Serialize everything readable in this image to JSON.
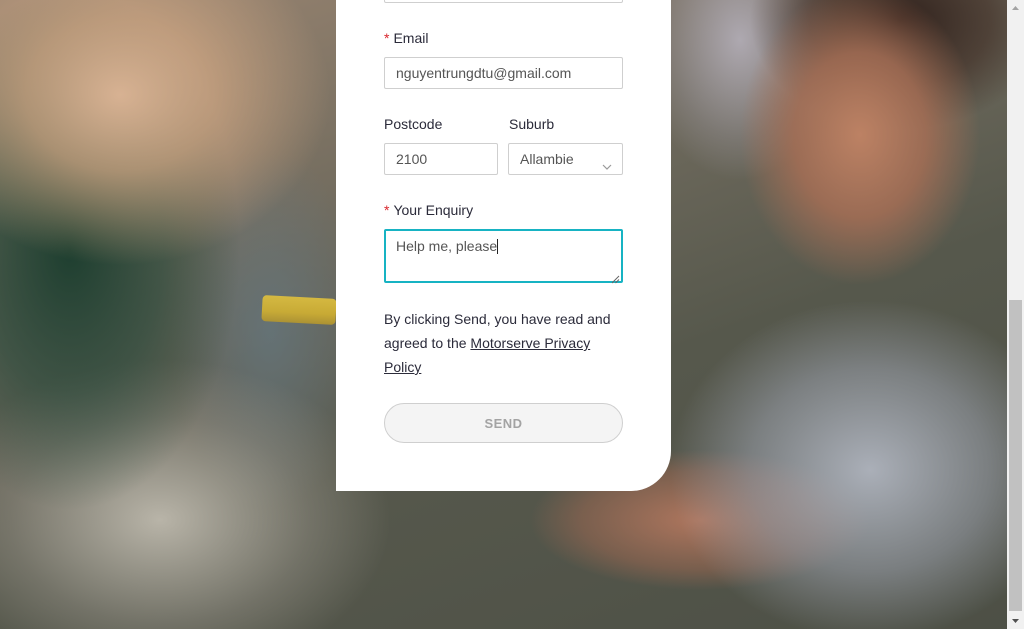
{
  "form": {
    "email": {
      "required_mark": "*",
      "label": "Email",
      "value": "nguyentrungdtu@gmail.com"
    },
    "postcode": {
      "label": "Postcode",
      "value": "2100"
    },
    "suburb": {
      "label": "Suburb",
      "selected": "Allambie"
    },
    "enquiry": {
      "required_mark": "*",
      "label": "Your Enquiry",
      "value": "Help me, please"
    },
    "policy": {
      "text_before": "By clicking Send, you have read and agreed to the ",
      "link_text": "Motorserve Privacy Policy"
    },
    "send_label": "SEND"
  },
  "colors": {
    "required": "#d8262d",
    "focus_border": "#17b3c3",
    "text": "#2b2b3a",
    "button_text_disabled": "#a3a3a3"
  },
  "icons": {
    "suburb_dropdown": "chevron-down-icon",
    "textarea_resize": "resize-grip-icon",
    "scroll_up": "arrow-up-icon",
    "scroll_down": "arrow-down-icon"
  }
}
